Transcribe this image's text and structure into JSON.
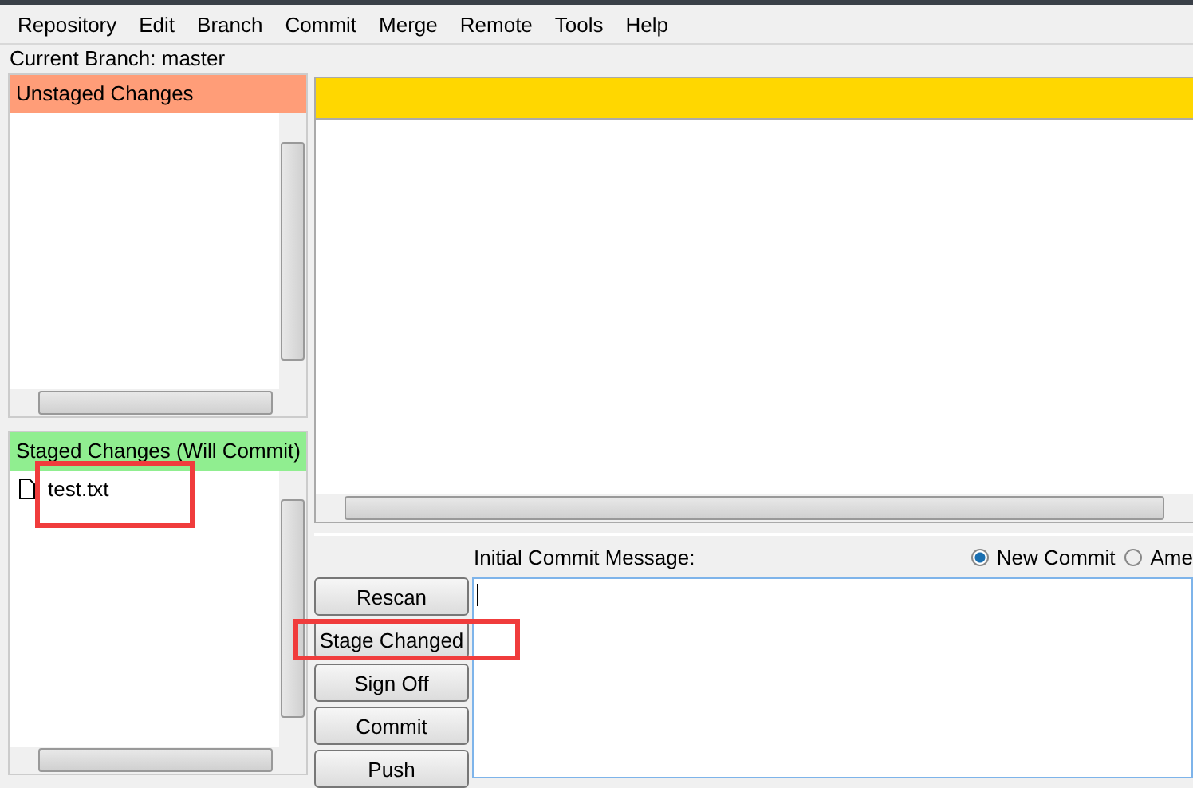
{
  "menu": [
    "Repository",
    "Edit",
    "Branch",
    "Commit",
    "Merge",
    "Remote",
    "Tools",
    "Help"
  ],
  "current_branch": "Current Branch: master",
  "unstaged": {
    "title": "Unstaged Changes"
  },
  "staged": {
    "title": "Staged Changes (Will Commit)",
    "files": [
      {
        "name": "test.txt",
        "highlighted": true
      }
    ]
  },
  "commit": {
    "label": "Initial Commit Message:",
    "modes": [
      {
        "label": "New Commit",
        "selected": true
      },
      {
        "label": "Ame",
        "selected": false
      }
    ],
    "buttons": [
      {
        "label": "Rescan",
        "highlighted": false
      },
      {
        "label": "Stage Changed",
        "highlighted": true
      },
      {
        "label": "Sign Off",
        "highlighted": false
      },
      {
        "label": "Commit",
        "highlighted": false
      },
      {
        "label": "Push",
        "highlighted": false
      }
    ]
  }
}
